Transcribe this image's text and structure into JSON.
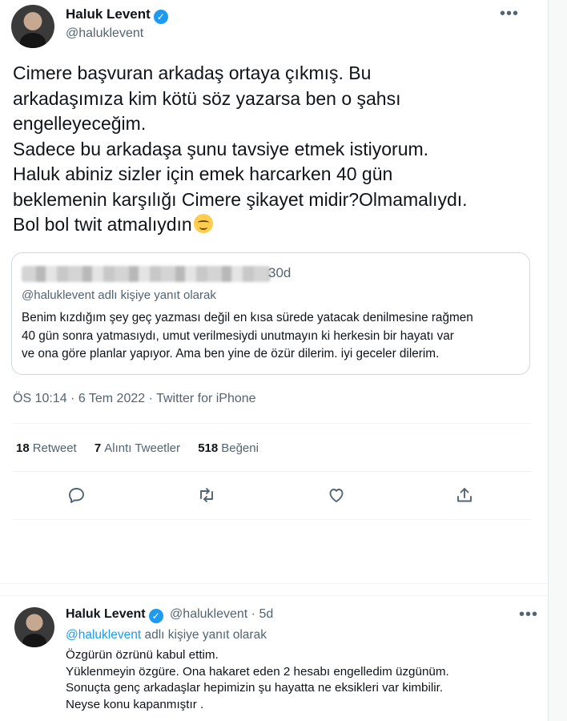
{
  "main_tweet": {
    "author_name": "Haluk Levent",
    "author_handle": "@haluklevent",
    "verified_icon": "verified-badge-icon",
    "text_lines": [
      "Cimere başvuran arkadaş ortaya çıkmış. Bu",
      "arkadaşımıza kim kötü söz yazarsa ben o şahsı",
      "engelleyeceğim.",
      "Sadece bu arkadaşa şunu tavsiye etmek istiyorum.",
      "Haluk abiniz sizler için emek harcarken 40 gün",
      "beklemenin karşılığı Cimere şikayet midir?Olmamalıydı.",
      "Bol bol twit atmalıydın"
    ],
    "emoji": "smiling-face-emoji",
    "timestamp": "ÖS 10:14 · 6 Tem 2022 · Twitter for iPhone",
    "quoted": {
      "time": "30d",
      "reply_to": "@haluklevent adlı kişiye yanıt olarak",
      "text_lines": [
        "Benim kızdığım şey geç yazması değil en kısa sürede yatacak denilmesine rağmen",
        "40 gün sonra yatmasıydı, umut verilmesiydi unutmayın ki herkesin bir hayatı var",
        "ve ona göre planlar yapıyor. Ama ben yine de özür dilerim. iyi geceler dilerim."
      ]
    },
    "stats": [
      {
        "count": "18",
        "label": "Retweet"
      },
      {
        "count": "7",
        "label": "Alıntı Tweetler"
      },
      {
        "count": "518",
        "label": "Beğeni"
      }
    ],
    "actions": [
      "reply-icon",
      "retweet-icon",
      "like-icon",
      "share-icon"
    ]
  },
  "reply_tweet": {
    "author_name": "Haluk Levent",
    "author_handle": "@haluklevent · 5d",
    "reply_to_link": "@haluklevent",
    "reply_to_suffix": " adlı kişiye yanıt olarak",
    "text_lines": [
      "Özgürün özrünü kabul ettim.",
      "Yüklenmeyin özgüre. Ona hakaret eden 2 hesabı engelledim üzgünüm.",
      "Sonuçta genç arkadaşlar hepimizin şu hayatta ne eksikleri var kimbilir.",
      "Neyse konu kapanmıştır ."
    ]
  },
  "colors": {
    "accent": "#1d9bf0",
    "text": "#0f1419",
    "muted": "#536471",
    "border": "#cfd9de"
  }
}
